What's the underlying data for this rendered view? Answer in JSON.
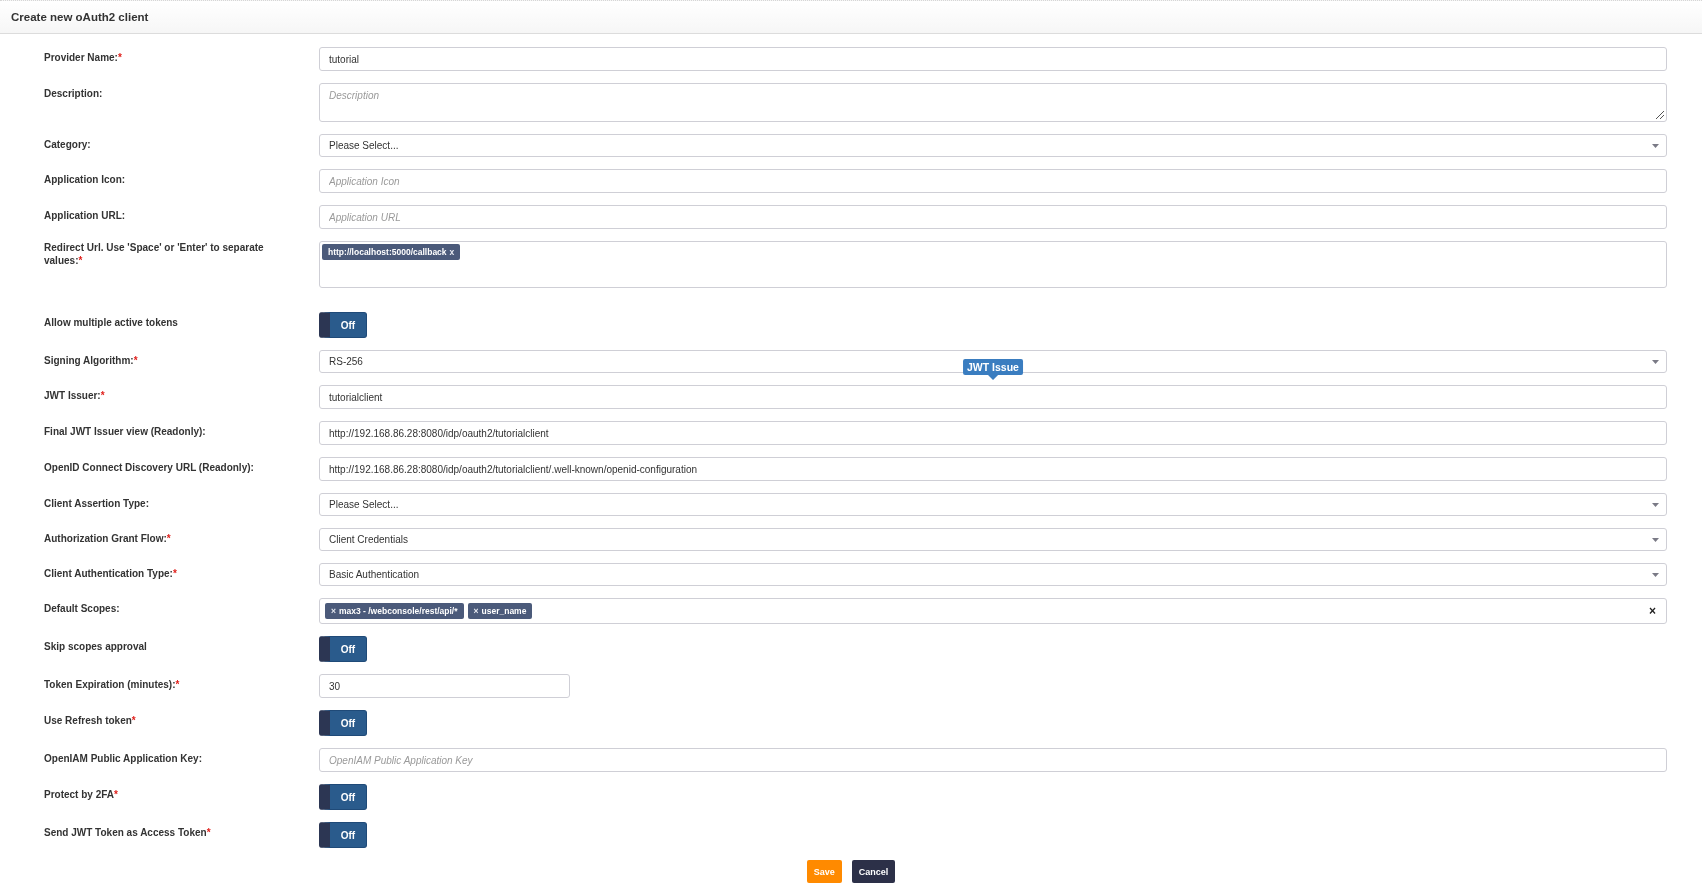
{
  "header": {
    "title": "Create new oAuth2 client"
  },
  "fields": [
    {
      "kind": "text",
      "label": "Provider Name:",
      "required_mark": "*",
      "value": "tutorial"
    },
    {
      "kind": "textarea",
      "label": "Description:",
      "placeholder": "Description"
    },
    {
      "kind": "select",
      "label": "Category:",
      "value": "Please Select..."
    },
    {
      "kind": "text",
      "label": "Application Icon:",
      "placeholder": "Application Icon"
    },
    {
      "kind": "text",
      "label": "Application URL:",
      "placeholder": "Application URL"
    },
    {
      "kind": "tags",
      "label": "Redirect Url. Use 'Space' or 'Enter' to separate values:",
      "required_mark": "*",
      "tags": [
        {
          "label": "http://localhost:5000/callback",
          "remove": "x"
        }
      ]
    },
    {
      "kind": "toggle",
      "label": "Allow multiple active tokens",
      "on": false,
      "state_text": "Off"
    },
    {
      "kind": "select",
      "label": "Signing Algorithm:",
      "required_mark": "*",
      "value": "RS-256"
    },
    {
      "kind": "text",
      "label": "JWT Issuer:",
      "required_mark": "*",
      "value": "tutorialclient",
      "tooltip": "JWT Issue"
    },
    {
      "kind": "text",
      "label": "Final JWT Issuer view (Readonly):",
      "value": "http://192.168.86.28:8080/idp/oauth2/tutorialclient"
    },
    {
      "kind": "text",
      "label": "OpenID Connect Discovery URL (Readonly):",
      "value": "http://192.168.86.28:8080/idp/oauth2/tutorialclient/.well-known/openid-configuration"
    },
    {
      "kind": "select",
      "label": "Client Assertion Type:",
      "value": "Please Select..."
    },
    {
      "kind": "select",
      "label": "Authorization Grant Flow:",
      "required_mark": "*",
      "value": "Client Credentials"
    },
    {
      "kind": "select",
      "label": "Client Authentication Type:",
      "required_mark": "*",
      "value": "Basic Authentication"
    },
    {
      "kind": "scopes",
      "label": "Default Scopes:",
      "tags": [
        {
          "remove": "×",
          "label": "max3 - /webconsole/rest/api/*"
        },
        {
          "remove": "×",
          "label": "user_name"
        }
      ],
      "clear": "×"
    },
    {
      "kind": "toggle",
      "label": "Skip scopes approval",
      "on": false,
      "state_text": "Off"
    },
    {
      "kind": "number",
      "label": "Token Expiration (minutes):",
      "required_mark": "*",
      "value": "30"
    },
    {
      "kind": "toggle",
      "label": "Use Refresh token",
      "required_mark": "*",
      "on": false,
      "state_text": "Off"
    },
    {
      "kind": "text",
      "label": "OpenIAM Public Application Key:",
      "placeholder": "OpenIAM Public Application Key"
    },
    {
      "kind": "toggle",
      "label": "Protect by 2FA",
      "required_mark": "*",
      "on": false,
      "state_text": "Off"
    },
    {
      "kind": "toggle",
      "label": "Send JWT Token as Access Token",
      "required_mark": "*",
      "on": false,
      "state_text": "Off"
    }
  ],
  "buttons": [
    {
      "kind": "primary",
      "label": "Save"
    },
    {
      "kind": "secondary",
      "label": "Cancel"
    }
  ]
}
